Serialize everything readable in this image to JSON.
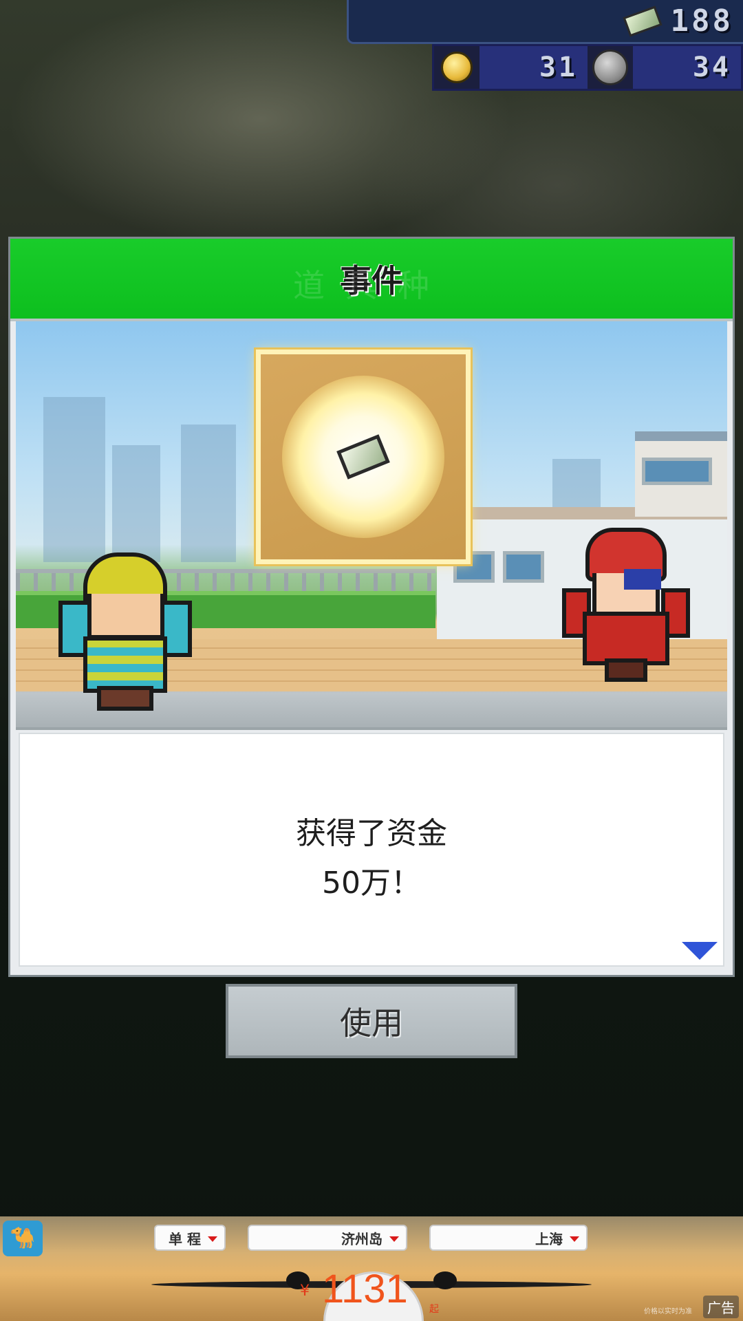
{
  "hud": {
    "money": "188",
    "ideas": "31",
    "medals": "34",
    "icons": [
      "money-icon",
      "lightbulb-icon",
      "medal-icon"
    ]
  },
  "dialog": {
    "title": "事件",
    "ghost_title": "道具种",
    "message_line1": "获得了资金",
    "message_line2": "50万！",
    "header_color": "#14c625"
  },
  "actions": {
    "use_label": "使用"
  },
  "ad": {
    "trip_type": "单 程",
    "from": "济州岛",
    "to": "上海",
    "currency": "¥",
    "price": "1131",
    "price_suffix": "起",
    "tag": "广告",
    "disclaimer": "价格以实时为准"
  }
}
